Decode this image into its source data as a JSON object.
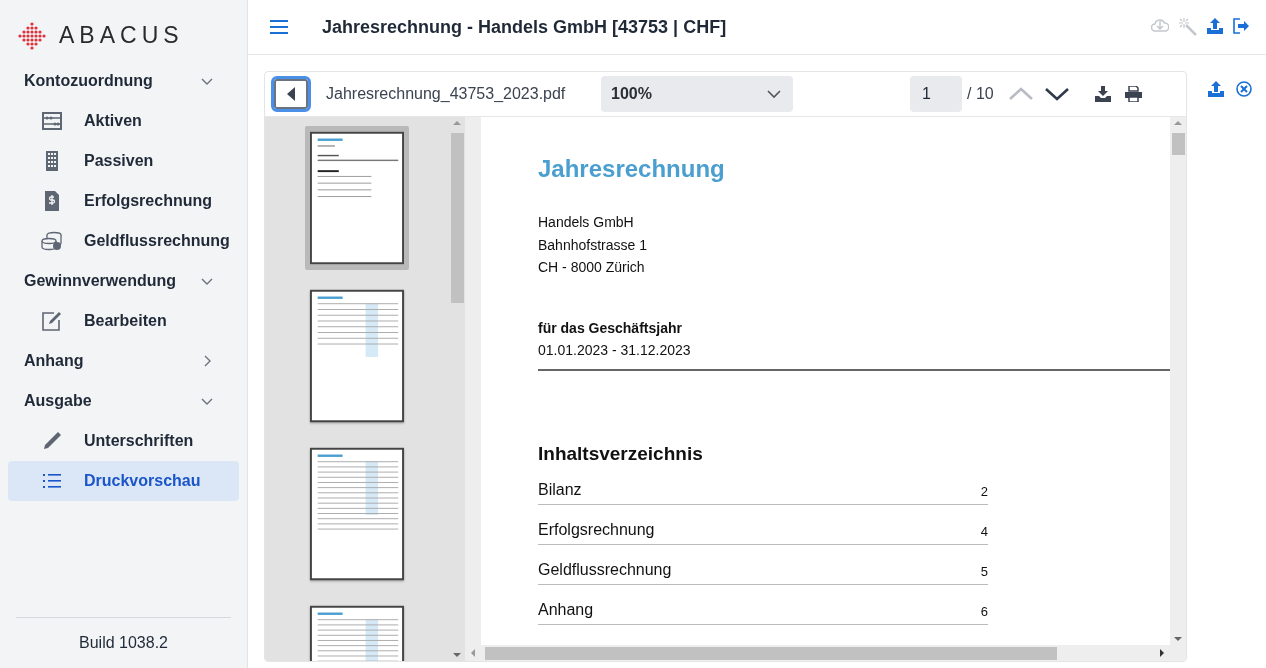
{
  "logo": {
    "text": "ABACUS"
  },
  "sidebar": {
    "sections": [
      {
        "label": "Kontozuordnung",
        "expanded": true,
        "items": [
          {
            "label": "Aktiven",
            "selected": false
          },
          {
            "label": "Passiven",
            "selected": false
          },
          {
            "label": "Erfolgsrechnung",
            "selected": false
          },
          {
            "label": "Geldflussrechnung",
            "selected": false
          }
        ]
      },
      {
        "label": "Gewinnverwendung",
        "expanded": true,
        "items": [
          {
            "label": "Bearbeiten",
            "selected": false
          }
        ]
      },
      {
        "label": "Anhang",
        "expanded": false
      },
      {
        "label": "Ausgabe",
        "expanded": true,
        "items": [
          {
            "label": "Unterschriften",
            "selected": false
          },
          {
            "label": "Druckvorschau",
            "selected": true
          }
        ]
      }
    ],
    "build": "Build 1038.2"
  },
  "header": {
    "title": "Jahresrechnung - Handels GmbH [43753 | CHF]",
    "actions": [
      {
        "disabled": true
      },
      {
        "disabled": true
      },
      {
        "disabled": false
      },
      {
        "disabled": false
      }
    ]
  },
  "viewer": {
    "filename": "Jahresrechnung_43753_2023.pdf",
    "zoom": "100%",
    "page": "1",
    "page_count": "/ 10",
    "prev_disabled": true,
    "next_disabled": false,
    "thumbnails": [
      {
        "selected": true
      },
      {
        "selected": false
      },
      {
        "selected": false
      },
      {
        "selected": false
      }
    ],
    "document": {
      "title": "Jahresrechnung",
      "address": [
        "Handels GmbH",
        "Bahnhofstrasse 1",
        "CH - 8000 Zürich"
      ],
      "period_label": "für das Geschäftsjahr",
      "period": "01.01.2023 - 31.12.2023",
      "toc_title": "Inhaltsverzeichnis",
      "toc": [
        {
          "label": "Bilanz",
          "page": "2"
        },
        {
          "label": "Erfolgsrechnung",
          "page": "4"
        },
        {
          "label": "Geldflussrechnung",
          "page": "5"
        },
        {
          "label": "Anhang",
          "page": "6"
        }
      ]
    }
  }
}
